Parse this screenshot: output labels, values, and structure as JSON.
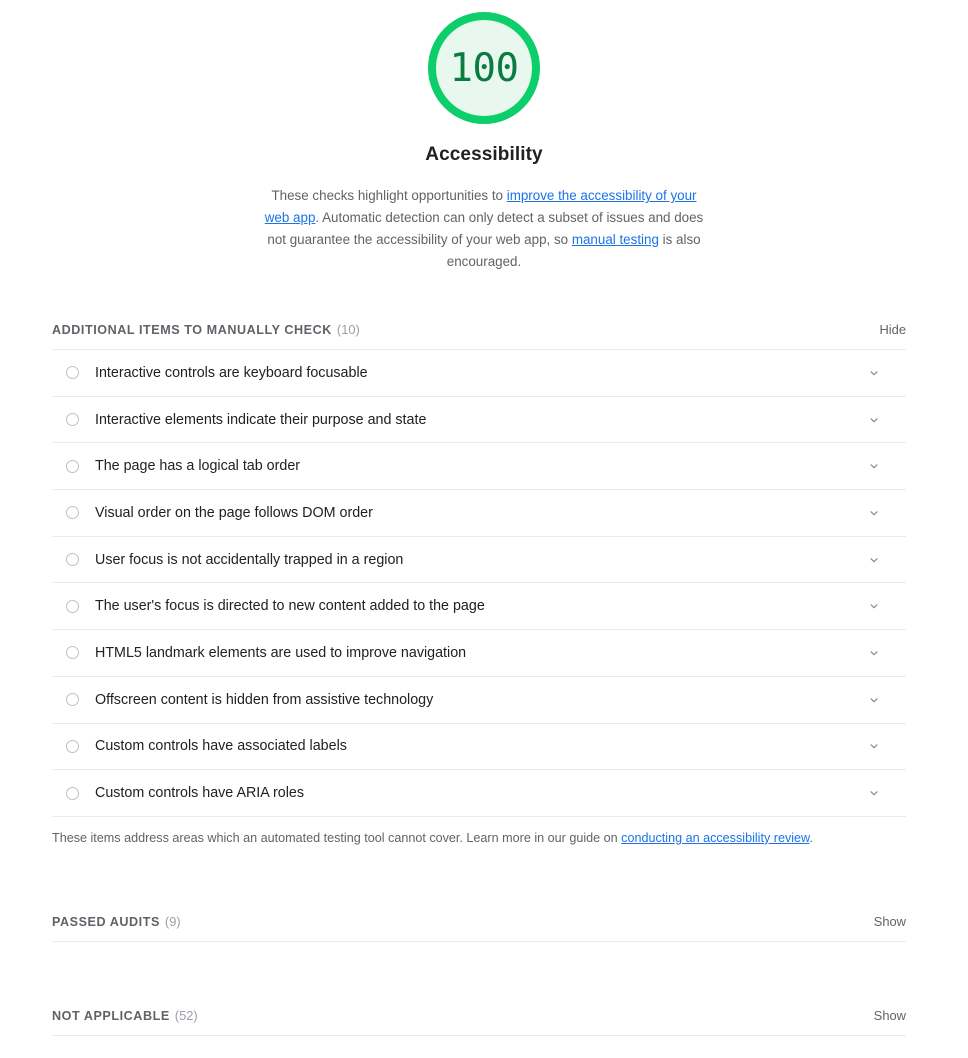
{
  "gauge": {
    "score": "100",
    "title": "Accessibility",
    "ring_color": "#0cce6b",
    "fill_color": "#e8f8ef",
    "value_color": "#0a7c42"
  },
  "description": {
    "part1": "These checks highlight opportunities to ",
    "link1": "improve the accessibility of your web app",
    "part2": ". Automatic detection can only detect a subset of issues and does not guarantee the accessibility of your web app, so ",
    "link2": "manual testing",
    "part3": " is also encouraged."
  },
  "sections": {
    "manual": {
      "title": "ADDITIONAL ITEMS TO MANUALLY CHECK",
      "count": "(10)",
      "toggle_label": "Hide",
      "items": [
        {
          "title": "Interactive controls are keyboard focusable",
          "icon": "circle-outline-icon",
          "chevron": "chevron-down-icon"
        },
        {
          "title": "Interactive elements indicate their purpose and state",
          "icon": "circle-outline-icon",
          "chevron": "chevron-down-icon"
        },
        {
          "title": "The page has a logical tab order",
          "icon": "circle-outline-icon",
          "chevron": "chevron-down-icon"
        },
        {
          "title": "Visual order on the page follows DOM order",
          "icon": "circle-outline-icon",
          "chevron": "chevron-down-icon"
        },
        {
          "title": "User focus is not accidentally trapped in a region",
          "icon": "circle-outline-icon",
          "chevron": "chevron-down-icon"
        },
        {
          "title": "The user's focus is directed to new content added to the page",
          "icon": "circle-outline-icon",
          "chevron": "chevron-down-icon"
        },
        {
          "title": "HTML5 landmark elements are used to improve navigation",
          "icon": "circle-outline-icon",
          "chevron": "chevron-down-icon"
        },
        {
          "title": "Offscreen content is hidden from assistive technology",
          "icon": "circle-outline-icon",
          "chevron": "chevron-down-icon"
        },
        {
          "title": "Custom controls have associated labels",
          "icon": "circle-outline-icon",
          "chevron": "chevron-down-icon"
        },
        {
          "title": "Custom controls have ARIA roles",
          "icon": "circle-outline-icon",
          "chevron": "chevron-down-icon"
        }
      ],
      "note_part1": "These items address areas which an automated testing tool cannot cover. Learn more in our guide on ",
      "note_link": "conducting an accessibility review",
      "note_part2": "."
    },
    "passed": {
      "title": "PASSED AUDITS",
      "count": "(9)",
      "toggle_label": "Show"
    },
    "not_applicable": {
      "title": "NOT APPLICABLE",
      "count": "(52)",
      "toggle_label": "Show"
    }
  },
  "colors": {
    "link": "#1a73e8",
    "text": "#202124",
    "muted": "#5f6368",
    "divider": "#ebebeb"
  }
}
